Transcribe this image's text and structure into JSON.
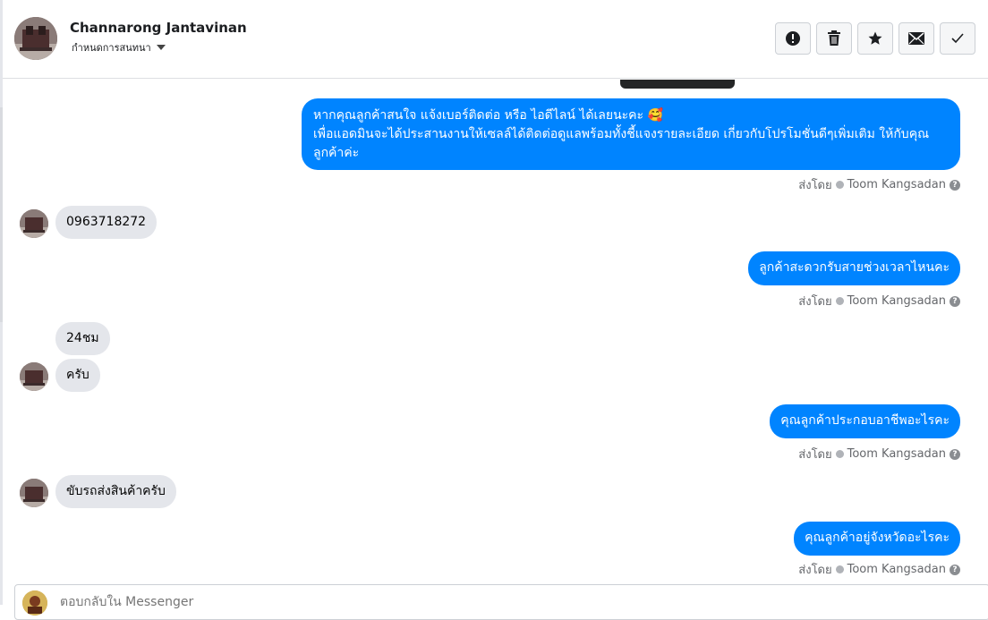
{
  "header": {
    "contact_name": "Channarong Jantavinan",
    "status_label": "กำหนดการสนทนา",
    "actions": [
      {
        "name": "report",
        "icon": "exclamation-circle-icon"
      },
      {
        "name": "delete",
        "icon": "trash-icon"
      },
      {
        "name": "star",
        "icon": "star-icon"
      },
      {
        "name": "mark-unread",
        "icon": "envelope-icon"
      },
      {
        "name": "mark-done",
        "icon": "checkmark-icon"
      }
    ]
  },
  "messages": [
    {
      "direction": "out",
      "text": "หากคุณลูกค้าสนใจ แจ้งเบอร์ติดต่อ หรือ ไอดีไลน์ ได้เลยนะคะ 🥰\nเพื่อแอดมินจะได้ประสานงานให้เซลล์ได้ติดต่อดูแลพร้อมทั้งชี้แจงรายละเอียด เกี่ยวกับโปรโมชั่นดีๆเพิ่มเติม ให้กับคุณลูกค้าค่ะ"
    },
    {
      "direction": "in",
      "text": "0963718272"
    },
    {
      "direction": "out",
      "text": "ลูกค้าสะดวกรับสายช่วงเวลาไหนคะ"
    },
    {
      "direction": "in",
      "text": "24ชม"
    },
    {
      "direction": "in",
      "text": "ครับ"
    },
    {
      "direction": "out",
      "text": "คุณลูกค้าประกอบอาชีพอะไรคะ"
    },
    {
      "direction": "in",
      "text": "ขับรถส่งสินค้าครับ"
    },
    {
      "direction": "out",
      "text": "คุณลูกค้าอยู่จังหวัดอะไรคะ"
    }
  ],
  "sent_by": {
    "prefix": "ส่งโดย",
    "agent": "Toom Kangsadan"
  },
  "composer": {
    "placeholder": "ตอบกลับใน Messenger"
  },
  "colors": {
    "outgoing_bubble": "#0084ff",
    "incoming_bubble": "#e4e6eb",
    "meta_text": "#65676b"
  }
}
